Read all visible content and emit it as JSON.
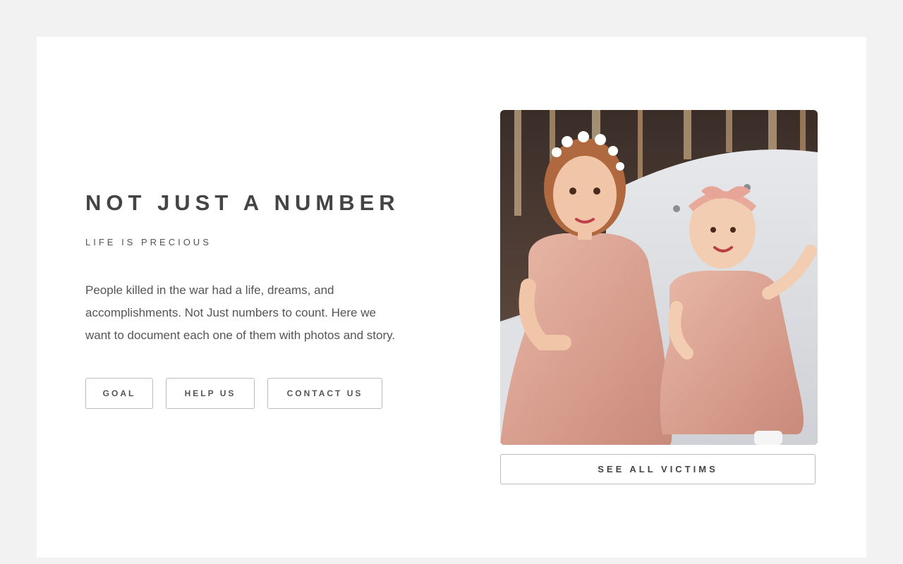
{
  "hero": {
    "title": "NOT JUST A NUMBER",
    "subtitle": "LIFE IS PRECIOUS",
    "description": "People killed in the war had a life, dreams, and accomplishments. Not Just numbers to count. Here we want to document each one of them with photos and story."
  },
  "buttons": {
    "goal": "GOAL",
    "help": "HELP US",
    "contact": "CONTACT US",
    "see_all": "SEE ALL VICTIMS"
  },
  "photo": {
    "alt": "photo-of-two-girls-in-pink-dresses"
  },
  "colors": {
    "page_background": "#f2f2f2",
    "card_background": "#ffffff",
    "text": "#444444",
    "button_border": "#bdbdbd"
  }
}
